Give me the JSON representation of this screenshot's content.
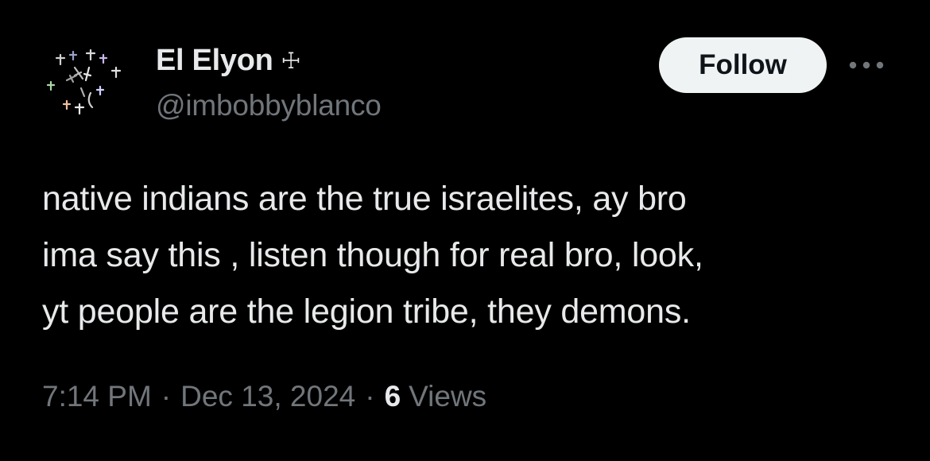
{
  "author": {
    "display_name": "El Elyon",
    "name_symbol": "☩",
    "handle": "@imbobbyblanco",
    "avatar_icon": "crosses-pattern-avatar"
  },
  "actions": {
    "follow_label": "Follow",
    "more_icon": "ellipsis-icon"
  },
  "tweet": {
    "lines": [
      "native indians are the true israelites, ay bro",
      "ima say this , listen though for real bro, look,",
      "yt people are the legion tribe, they demons."
    ]
  },
  "meta": {
    "time": "7:14 PM",
    "separator": "·",
    "date": "Dec 13, 2024",
    "views_count": "6",
    "views_label": "Views"
  },
  "colors": {
    "background": "#000000",
    "primary_text": "#e7e9ea",
    "secondary_text": "#71767b",
    "follow_bg": "#eff3f4",
    "follow_text": "#0f1419"
  }
}
